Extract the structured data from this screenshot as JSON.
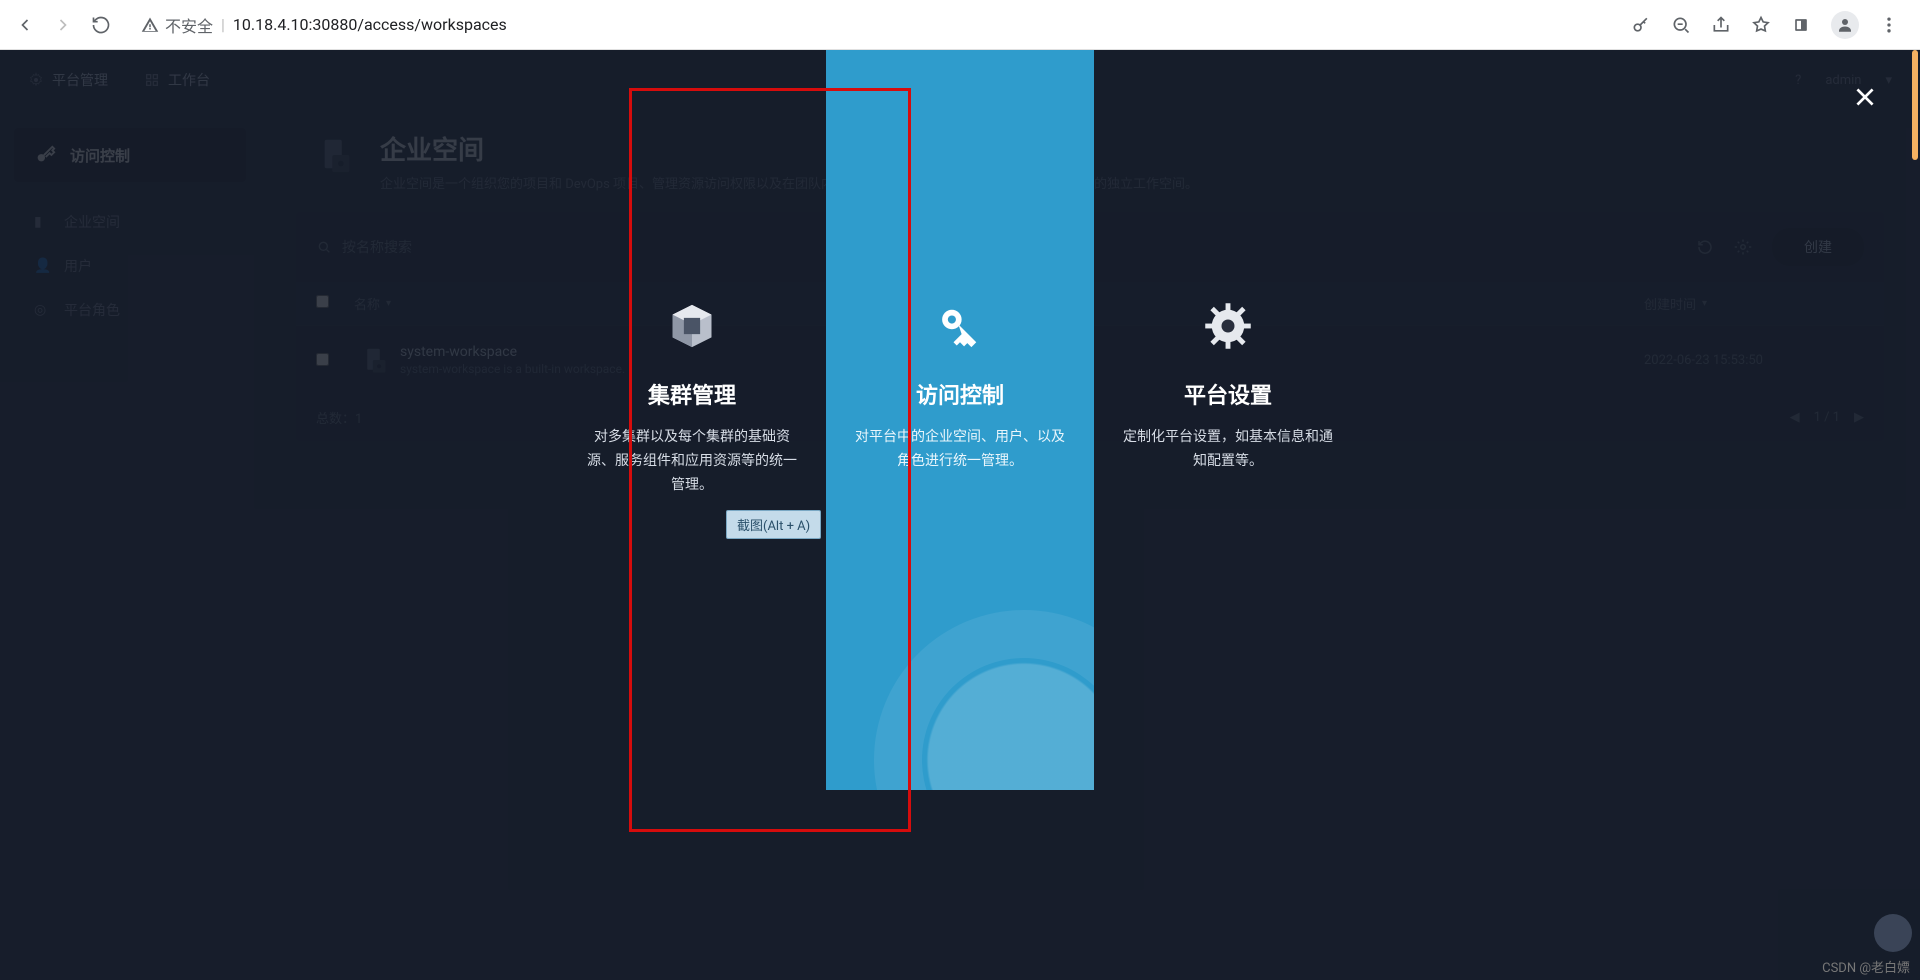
{
  "browser": {
    "security_label": "不安全",
    "url": "10.18.4.10:30880/access/workspaces"
  },
  "topbar": {
    "items": [
      "平台管理",
      "工作台"
    ],
    "help": "?",
    "user": "admin"
  },
  "sidebar": {
    "active": {
      "label": "访问控制"
    },
    "items": [
      {
        "label": "企业空间"
      },
      {
        "label": "用户"
      },
      {
        "label": "平台角色"
      }
    ]
  },
  "hero": {
    "title": "企业空间",
    "desc": "企业空间是一个组织您的项目和 DevOps 项目、管理资源访问权限以及在团队内部共享资源等的逻辑单元，可以作为团队工作的独立工作空间。"
  },
  "panel": {
    "search_placeholder": "按名称搜索",
    "create_label": "创建",
    "col_name": "名称",
    "col_time": "创建时间",
    "row_name": "system-workspace",
    "row_sub": "system-workspace is a built-in workspace.",
    "row_time": "2022-06-23 15:53:50",
    "total_label": "总数：",
    "total_value": "1",
    "page": "1 / 1"
  },
  "overlay": {
    "cards": [
      {
        "title": "集群管理",
        "desc": "对多集群以及每个集群的基础资源、服务组件和应用资源等的统一管理。"
      },
      {
        "title": "访问控制",
        "desc": "对平台中的企业空间、用户、以及角色进行统一管理。"
      },
      {
        "title": "平台设置",
        "desc": "定制化平台设置，如基本信息和通知配置等。"
      }
    ],
    "hint": "截图(Alt + A)"
  },
  "watermark": "CSDN @老白嫖"
}
